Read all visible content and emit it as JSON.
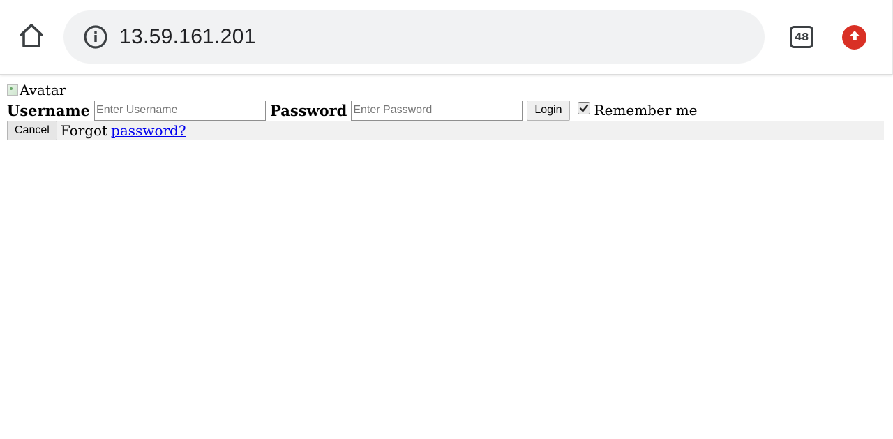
{
  "browser": {
    "url": "13.59.161.201",
    "tab_count": "48",
    "icons": {
      "home": "home-icon",
      "info": "info-icon",
      "tabs": "tab-counter-icon",
      "update": "update-arrow-icon"
    },
    "colors": {
      "update_accent": "#d93025",
      "address_bar_bg": "#f1f2f3"
    }
  },
  "page": {
    "avatar_alt": "Avatar",
    "username_label": "Username",
    "username_placeholder": "Enter Username",
    "password_label": "Password",
    "password_placeholder": "Enter Password",
    "login_button": "Login",
    "remember_checked": true,
    "remember_label": "Remember me",
    "cancel_button": "Cancel",
    "forgot_text": "Forgot",
    "forgot_link": "password?",
    "colors": {
      "link": "#0000ee",
      "footer_bg": "#f1f1f1"
    }
  }
}
